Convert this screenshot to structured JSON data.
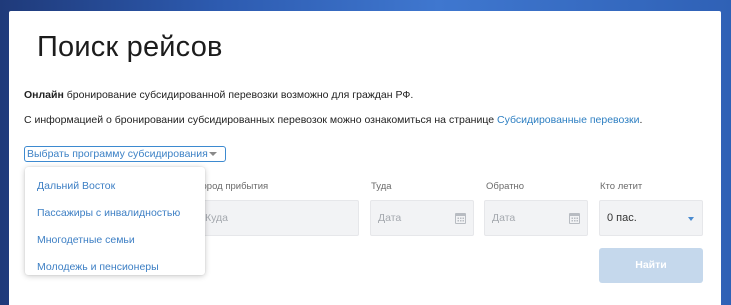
{
  "page": {
    "title": "Поиск рейсов",
    "info_bold": "Онлайн",
    "info_rest": " бронирование субсидированной перевозки возможно для граждан РФ.",
    "info2_text": "С информацией о бронировании субсидированных перевозок можно ознакомиться на странице ",
    "info2_link": "Субсидированные перевозки",
    "info2_end": "."
  },
  "program_select": {
    "label": "Выбрать программу субсидирования",
    "options": [
      "Дальний Восток",
      "Пассажиры с инвалидностью",
      "Многодетные семьи",
      "Молодежь и пенсионеры"
    ]
  },
  "form": {
    "arrival_label": "Город прибытия",
    "arrival_placeholder": "Куда",
    "there_label": "Туда",
    "there_placeholder": "Дата",
    "back_label": "Обратно",
    "back_placeholder": "Дата",
    "passengers_label": "Кто летит",
    "passengers_value": "0 пас.",
    "search_button": "Найти"
  },
  "colors": {
    "accent": "#3d8ad0",
    "link": "#2d7fc2",
    "button_disabled": "#c5d8ec"
  }
}
